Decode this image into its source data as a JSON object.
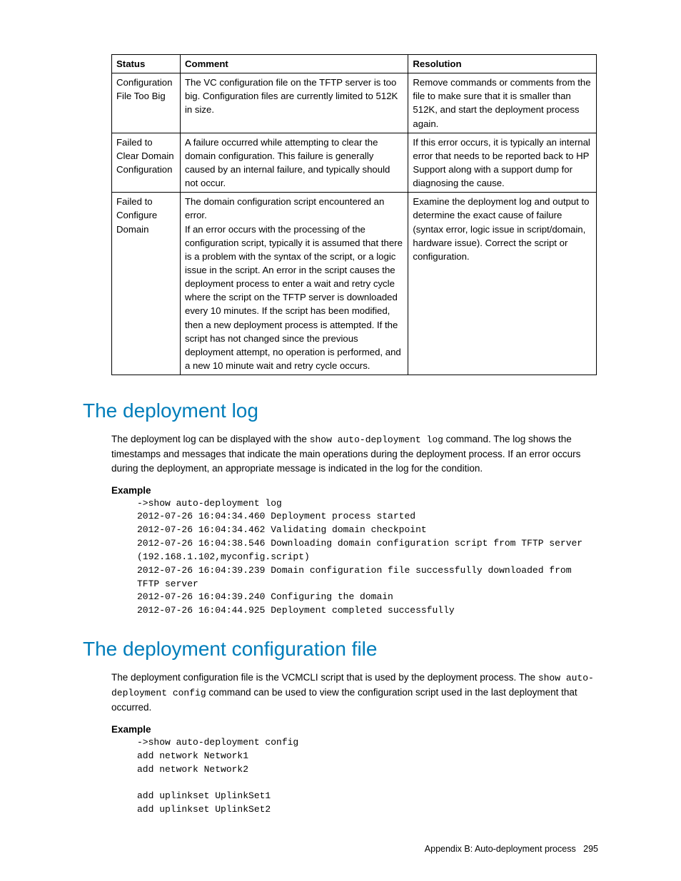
{
  "table": {
    "headers": {
      "status": "Status",
      "comment": "Comment",
      "resolution": "Resolution"
    },
    "rows": [
      {
        "status": "Configuration File Too Big",
        "comment": "The VC configuration file on the TFTP server is too big. Configuration files are currently limited to 512K in size.",
        "resolution": "Remove commands or comments from the file to make sure that it is smaller than 512K, and start the deployment process again."
      },
      {
        "status": "Failed to Clear Domain Configuration",
        "comment": "A failure occurred while attempting to clear the domain configuration. This failure is generally caused by an internal failure, and typically should not occur.",
        "resolution": "If this error occurs, it is typically an internal error that needs to be reported back to HP Support along with a support dump for diagnosing the cause."
      },
      {
        "status": "Failed to Configure Domain",
        "comment": "The domain configuration script encountered an error.\nIf an error occurs with the processing of the configuration script, typically it is assumed that there is a problem with the syntax of the script, or a logic issue in the script. An error in the script causes the deployment process to enter a wait and retry cycle where the script on the TFTP server is downloaded every 10 minutes. If the script has been modified, then a new deployment process is attempted. If the script has not changed since the previous deployment attempt, no operation is performed, and a new 10 minute wait and retry cycle occurs.",
        "resolution": "Examine the deployment log and output to determine the exact cause of failure (syntax error, logic issue in script/domain, hardware issue). Correct the script or configuration."
      }
    ]
  },
  "section1": {
    "heading": "The deployment log",
    "para_pre": "The deployment log can be displayed with the ",
    "para_cmd": "show auto-deployment log",
    "para_post": " command. The log shows the timestamps and messages that indicate the main operations during the deployment process. If an error occurs during the deployment, an appropriate message is indicated in the log for the condition.",
    "example_label": "Example",
    "code": "->show auto-deployment log\n2012-07-26 16:04:34.460 Deployment process started\n2012-07-26 16:04:34.462 Validating domain checkpoint\n2012-07-26 16:04:38.546 Downloading domain configuration script from TFTP server (192.168.1.102,myconfig.script)\n2012-07-26 16:04:39.239 Domain configuration file successfully downloaded from TFTP server\n2012-07-26 16:04:39.240 Configuring the domain\n2012-07-26 16:04:44.925 Deployment completed successfully"
  },
  "section2": {
    "heading": "The deployment configuration file",
    "para_pre": "The deployment configuration file is the VCMCLI script that is used by the deployment process. The ",
    "para_cmd": "show auto-deployment config",
    "para_post": " command can be used to view the configuration script used in the last deployment that occurred.",
    "example_label": "Example",
    "code": "->show auto-deployment config\nadd network Network1\nadd network Network2\n\nadd uplinkset UplinkSet1\nadd uplinkset UplinkSet2"
  },
  "footer": {
    "text": "Appendix B: Auto-deployment process",
    "page": "295"
  }
}
